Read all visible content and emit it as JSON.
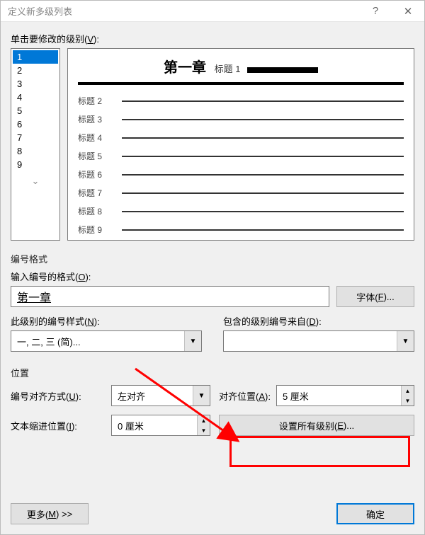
{
  "titlebar": {
    "title": "定义新多级列表"
  },
  "level_section": {
    "label_pre": "单击要修改的级别(",
    "label_key": "V",
    "label_post": "):",
    "levels": [
      "1",
      "2",
      "3",
      "4",
      "5",
      "6",
      "7",
      "8",
      "9"
    ],
    "selected": "1"
  },
  "preview": {
    "chapter": "第一章",
    "heading1": "标题 1",
    "rows": [
      "标题 2",
      "标题 3",
      "标题 4",
      "标题 5",
      "标题 6",
      "标题 7",
      "标题 8",
      "标题 9"
    ]
  },
  "fmt": {
    "group": "编号格式",
    "number_format_label_pre": "输入编号的格式(",
    "number_format_label_key": "O",
    "number_format_label_post": "):",
    "number_format_value": "第一章",
    "font_button_pre": "字体(",
    "font_button_key": "F",
    "font_button_post": ")...",
    "style_label_pre": "此级别的编号样式(",
    "style_label_key": "N",
    "style_label_post": "):",
    "style_value": "一, 二, 三 (简)...",
    "include_label_pre": "包含的级别编号来自(",
    "include_label_key": "D",
    "include_label_post": "):",
    "include_value": ""
  },
  "pos": {
    "group": "位置",
    "align_label_pre": "编号对齐方式(",
    "align_label_key": "U",
    "align_label_post": "):",
    "align_value": "左对齐",
    "align_at_pre": "对齐位置(",
    "align_at_key": "A",
    "align_at_post": "):",
    "align_at_value": "5 厘米",
    "indent_label_pre": "文本缩进位置(",
    "indent_label_key": "I",
    "indent_label_post": "):",
    "indent_value": "0 厘米",
    "set_all_pre": "设置所有级别(",
    "set_all_key": "E",
    "set_all_post": ")..."
  },
  "footer": {
    "more_pre": "更多(",
    "more_key": "M",
    "more_post": ") >>",
    "ok": "确定"
  }
}
